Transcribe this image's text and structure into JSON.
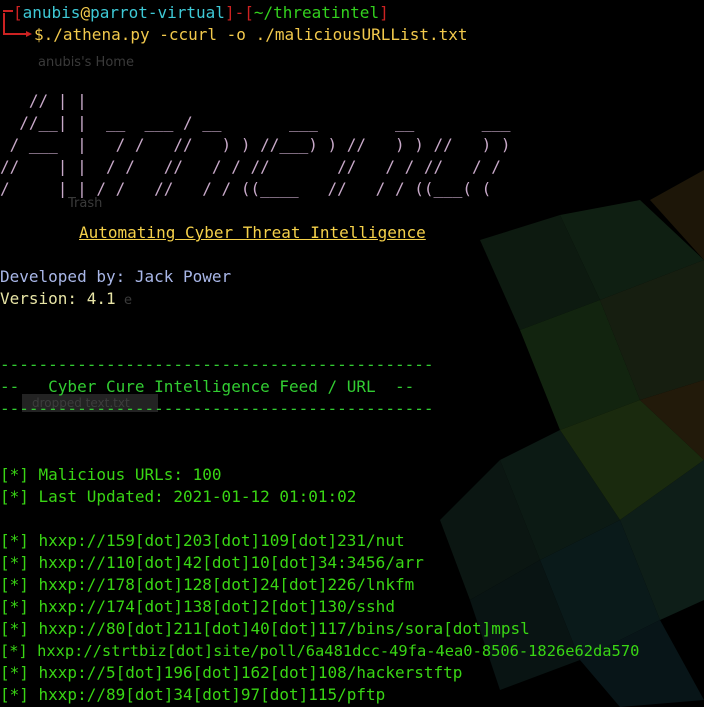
{
  "prompt": {
    "user": "anubis",
    "at": "@",
    "host": "parrot-virtual",
    "cwd": "~/threatintel",
    "symbol": "$",
    "command": "./athena.py -ccurl -o ./maliciousURLList.txt"
  },
  "desktop": {
    "home_label": "anubis's Home",
    "trash_label": "Trash",
    "file_label": "dropped text.txt",
    "partial_label": "e"
  },
  "banner": {
    "ascii_lines": [
      "   // | |",
      "  //__| |  __  ___ / __       ___        __       ___",
      " / ___  |   / /   //   ) ) //___) ) //   ) ) //   ) )",
      "//    | |  / /   //   / / //       //   / / //   / /",
      "/     | | / /   //   / / ((____   //   / / ((___( ("
    ],
    "subtitle": "Automating Cyber Threat Intelligence",
    "developed_by": "Developed by: Jack Power",
    "version": "Version: 4.1"
  },
  "feed": {
    "rule": "---------------------------------------------",
    "title": "--   Cyber Cure Intelligence Feed / URL  --",
    "count_line": "[*] Malicious URLs: 100",
    "updated_line": "[*] Last Updated: 2021-01-12 01:01:02",
    "urls": [
      "[*] hxxp://159[dot]203[dot]109[dot]231/nut",
      "[*] hxxp://110[dot]42[dot]10[dot]34:3456/arr",
      "[*] hxxp://178[dot]128[dot]24[dot]226/lnkfm",
      "[*] hxxp://174[dot]138[dot]2[dot]130/sshd",
      "[*] hxxp://80[dot]211[dot]40[dot]117/bins/sora[dot]mpsl",
      "[*] hxxp://strtbiz[dot]site/poll/6a481dcc-49fa-4ea0-8506-1826e62da570",
      "[*] hxxp://5[dot]196[dot]162[dot]108/hackerstftp",
      "[*] hxxp://89[dot]34[dot]97[dot]115/pftp"
    ]
  },
  "colors": {
    "background": "#000000",
    "prompt_red": "#cc2222",
    "prompt_cyan": "#3ec9d6",
    "command_yellow": "#f2c94c",
    "ascii_pink": "#c8a9c9",
    "green": "#39d614"
  }
}
